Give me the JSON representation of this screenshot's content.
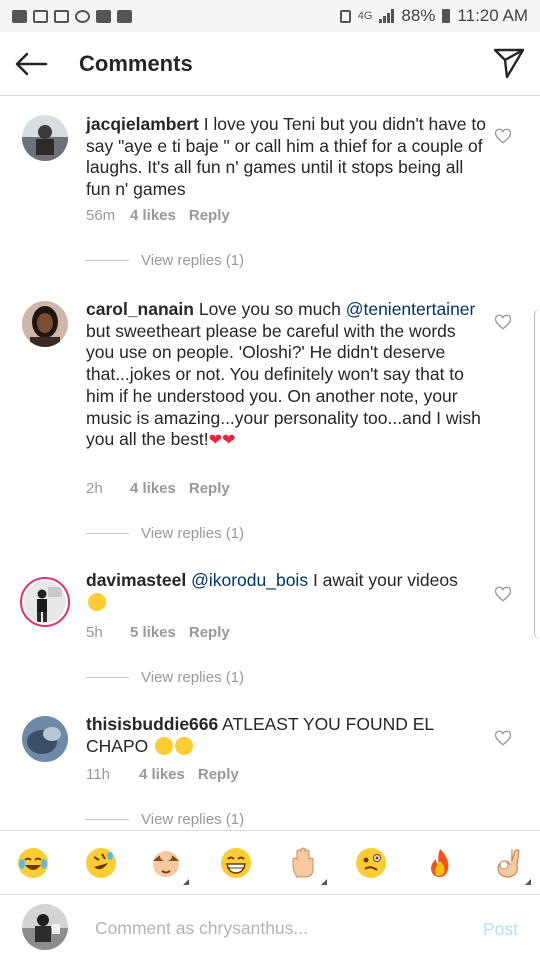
{
  "status_bar": {
    "battery": "88%",
    "time": "11:20 AM",
    "network": "4G"
  },
  "header": {
    "title": "Comments",
    "back_icon": "arrow-left-icon",
    "send_icon": "direct-send-icon"
  },
  "comments": [
    {
      "username": "jacqielambert",
      "text": " I love you Teni but you didn't have to say \"aye e ti baje \" or call him a thief  for a couple of laughs. It's all fun n' games until it stops being all fun n' games",
      "time": "56m",
      "likes": "4 likes",
      "reply": "Reply",
      "view_replies": "View replies (1)"
    },
    {
      "username": "carol_nanain",
      "text_before": " Love you so much ",
      "mention": "@tenientertainer",
      "text": " but sweetheart please be careful with the words you use on people. 'Oloshi?' He didn't deserve that...jokes or not. You definitely won't say that to him if he understood you. On another note, your music is amazing...your personality too...and I wish you all the best!",
      "hearts": "❤❤",
      "time": "2h",
      "likes": "4 likes",
      "reply": "Reply",
      "view_replies": "View replies (1)"
    },
    {
      "username": "davimasteel",
      "mention": "@ikorodu_bois",
      "text": " I await your videos",
      "time": "5h",
      "likes": "5 likes",
      "reply": "Reply",
      "view_replies": "View replies (1)"
    },
    {
      "username": "thisisbuddie666",
      "text": " ATLEAST YOU FOUND EL CHAPO",
      "time": "11h",
      "likes": "4 likes",
      "reply": "Reply",
      "view_replies": "View replies (1)"
    }
  ],
  "emoji_bar": [
    {
      "name": "tears-of-joy-emoji"
    },
    {
      "name": "rolling-laughing-emoji"
    },
    {
      "name": "facepalm-emoji"
    },
    {
      "name": "grinning-emoji"
    },
    {
      "name": "raised-hand-emoji"
    },
    {
      "name": "woozy-face-emoji"
    },
    {
      "name": "fire-emoji"
    },
    {
      "name": "ok-hand-emoji"
    }
  ],
  "input": {
    "placeholder": "Comment as chrysanthus...",
    "post_label": "Post"
  },
  "colors": {
    "text": "#262626",
    "meta": "#999999",
    "mention": "#003569",
    "post_disabled": "#b2dffc",
    "divider": "#dbdbdb"
  }
}
